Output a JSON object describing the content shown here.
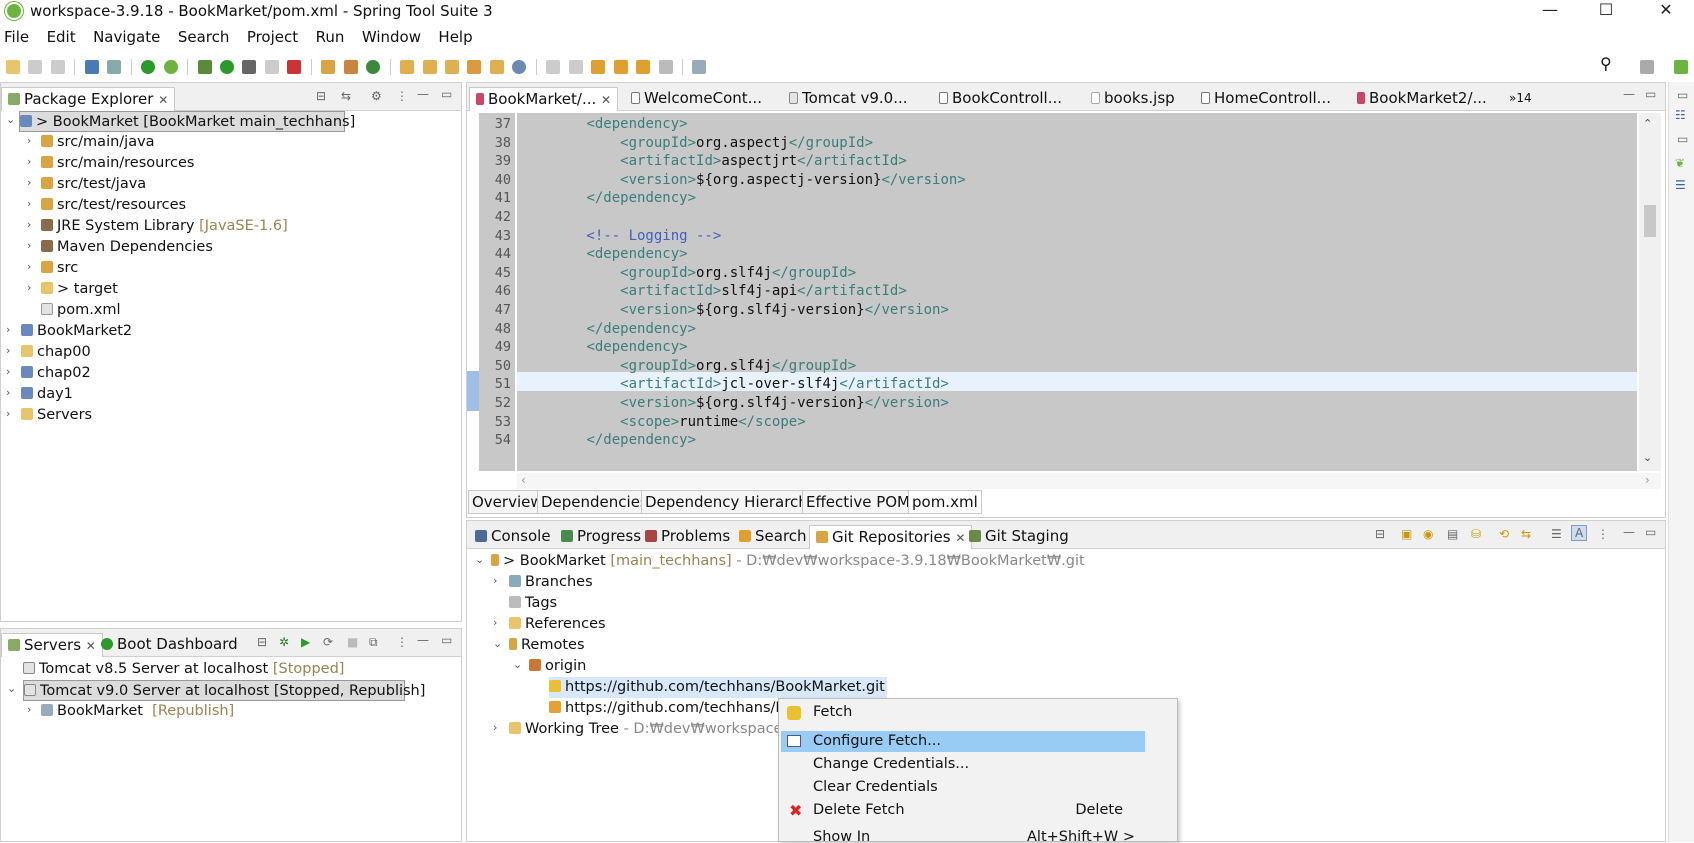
{
  "window": {
    "title": "workspace-3.9.18 - BookMarket/pom.xml - Spring Tool Suite 3",
    "minimize": "—",
    "maximize": "☐",
    "close": "✕"
  },
  "menu": [
    "File",
    "Edit",
    "Navigate",
    "Search",
    "Project",
    "Run",
    "Window",
    "Help"
  ],
  "package_explorer": {
    "tab_label": "Package Explorer",
    "items": [
      {
        "label": "> BookMarket [BookMarket main_techhans]",
        "suffix": ""
      },
      {
        "label": "src/main/java",
        "suffix": ""
      },
      {
        "label": "src/main/resources",
        "suffix": ""
      },
      {
        "label": "src/test/java",
        "suffix": ""
      },
      {
        "label": "src/test/resources",
        "suffix": ""
      },
      {
        "label": "JRE System Library",
        "suffix": "[JavaSE-1.6]"
      },
      {
        "label": "Maven Dependencies",
        "suffix": ""
      },
      {
        "label": "src",
        "suffix": ""
      },
      {
        "label": "> target",
        "suffix": ""
      },
      {
        "label": "pom.xml",
        "suffix": ""
      },
      {
        "label": "BookMarket2",
        "suffix": ""
      },
      {
        "label": "chap00",
        "suffix": ""
      },
      {
        "label": "chap02",
        "suffix": ""
      },
      {
        "label": "day1",
        "suffix": ""
      },
      {
        "label": "Servers",
        "suffix": ""
      }
    ]
  },
  "servers_panel": {
    "tab_servers": "Servers",
    "tab_boot": "Boot Dashboard",
    "items": [
      {
        "label": "Tomcat v8.5 Server at localhost",
        "status": "[Stopped]"
      },
      {
        "label": "Tomcat v9.0 Server at localhost",
        "status": "[Stopped, Republish]"
      },
      {
        "label": "BookMarket",
        "status": "[Republish]"
      }
    ]
  },
  "editor": {
    "tabs": [
      "BookMarket/...",
      "WelcomeCont...",
      "Tomcat v9.0...",
      "BookControll...",
      "books.jsp",
      "HomeControll...",
      "BookMarket2/..."
    ],
    "overflow": "»14",
    "lines": [
      {
        "n": "37",
        "code": "        <dependency>"
      },
      {
        "n": "38",
        "code": "            <groupId>org.aspectj</groupId>"
      },
      {
        "n": "39",
        "code": "            <artifactId>aspectjrt</artifactId>"
      },
      {
        "n": "40",
        "code": "            <version>${org.aspectj-version}</version>"
      },
      {
        "n": "41",
        "code": "        </dependency>"
      },
      {
        "n": "42",
        "code": ""
      },
      {
        "n": "43",
        "code": "        <!-- Logging -->"
      },
      {
        "n": "44",
        "code": "        <dependency>"
      },
      {
        "n": "45",
        "code": "            <groupId>org.slf4j</groupId>"
      },
      {
        "n": "46",
        "code": "            <artifactId>slf4j-api</artifactId>"
      },
      {
        "n": "47",
        "code": "            <version>${org.slf4j-version}</version>"
      },
      {
        "n": "48",
        "code": "        </dependency>"
      },
      {
        "n": "49",
        "code": "        <dependency>"
      },
      {
        "n": "50",
        "code": "            <groupId>org.slf4j</groupId>"
      },
      {
        "n": "51",
        "code": "            <artifactId>jcl-over-slf4j</artifactId>"
      },
      {
        "n": "52",
        "code": "            <version>${org.slf4j-version}</version>"
      },
      {
        "n": "53",
        "code": "            <scope>runtime</scope>"
      },
      {
        "n": "54",
        "code": "        </dependency>"
      }
    ],
    "pom_tabs": [
      "Overview",
      "Dependencies",
      "Dependency Hierarchy",
      "Effective POM",
      "pom.xml"
    ]
  },
  "bottom_panel": {
    "tabs": [
      "Console",
      "Progress",
      "Problems",
      "Search",
      "Git Repositories",
      "Git Staging"
    ],
    "repo": {
      "name": "> BookMarket",
      "branch": "[main_techhans]",
      "path": "- D:₩dev₩workspace-3.9.18₩BookMarket₩.git"
    },
    "nodes": [
      "Branches",
      "Tags",
      "References",
      "Remotes",
      "origin"
    ],
    "urls": [
      "https://github.com/techhans/BookMarket.git",
      "https://github.com/techhans/B"
    ],
    "working_tree": {
      "label": "Working Tree",
      "path": "- D:₩dev₩workspace-"
    }
  },
  "context_menu": {
    "items": [
      {
        "label": "Fetch",
        "shortcut": ""
      },
      {
        "label": "Configure Fetch...",
        "shortcut": ""
      },
      {
        "label": "Change Credentials...",
        "shortcut": ""
      },
      {
        "label": "Clear Credentials",
        "shortcut": ""
      },
      {
        "label": "Delete Fetch",
        "shortcut": "Delete"
      },
      {
        "label": "Show In",
        "shortcut": "Alt+Shift+W >"
      }
    ]
  },
  "colors": {
    "accent_highlight": "#99ccf5",
    "editor_bg": "#c8c8c8",
    "current_line": "#e8f2fe"
  }
}
